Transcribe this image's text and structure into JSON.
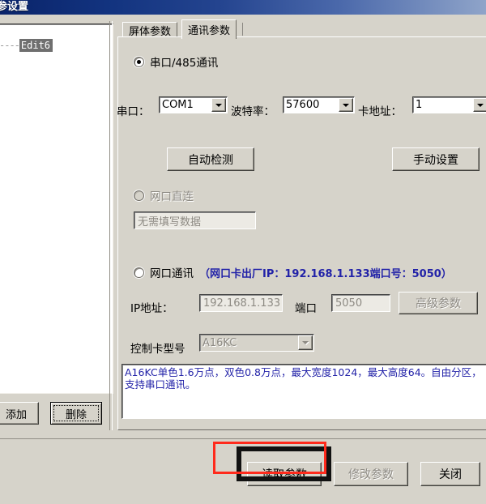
{
  "window": {
    "title": "参设置"
  },
  "left_panel": {
    "tree_item_prefix": "----",
    "tree_item_label": "Edit6",
    "add_label": "添加",
    "delete_label": "删除"
  },
  "tabs": [
    {
      "id": "screen",
      "label": "屏体参数",
      "active": false
    },
    {
      "id": "comm",
      "label": "通讯参数",
      "active": true
    }
  ],
  "comm_panel": {
    "serial_radio_label": "串口/485通讯",
    "port_label": "串口：",
    "port_value": "COM1",
    "baud_label": "波特率：",
    "baud_value": "57600",
    "card_addr_label": "卡地址：",
    "card_addr_value": "1",
    "auto_detect_label": "自动检测",
    "manual_setup_label": "手动设置",
    "direct_net_radio_label": "网口直连",
    "direct_net_field_value": "无需填写数据",
    "net_comm_radio_label": "网口通讯",
    "net_comm_note": "（网口卡出厂IP：192.168.1.133端口号：5050）",
    "ip_label": "IP地址：",
    "ip_value": "192.168.1.133",
    "port2_label": "端口",
    "port2_value": "5050",
    "advanced_label": "高级参数",
    "card_model_label": "控制卡型号",
    "card_model_value": "A16KC",
    "description": "A16KC单色1.6万点，双色0.8万点，最大宽度1024，最大高度64。自由分区，支持串口通讯。"
  },
  "footer": {
    "read_params_label": "读取参数",
    "modify_params_label": "修改参数",
    "close_label": "关闭"
  },
  "colors": {
    "titlebar": "#0a246a",
    "face": "#d6d3ca",
    "note_blue": "#2222a8",
    "highlight_red": "#ff2a1c",
    "disabled_text": "#8d8a83"
  }
}
